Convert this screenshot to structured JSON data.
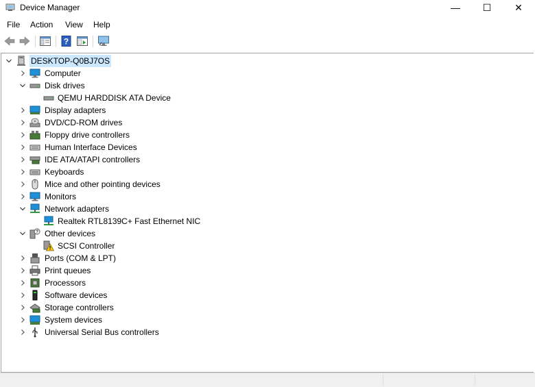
{
  "window": {
    "title": "Device Manager",
    "minimize": "—",
    "maximize": "☐",
    "close": "✕"
  },
  "menu": [
    {
      "label": "File"
    },
    {
      "label": "Action"
    },
    {
      "label": "View"
    },
    {
      "label": "Help"
    }
  ],
  "toolbar": [
    {
      "name": "back-button",
      "icon": "back-arrow-icon"
    },
    {
      "name": "forward-button",
      "icon": "forward-arrow-icon"
    },
    {
      "name": "show-hide-console-tree-button",
      "icon": "console-tree-icon"
    },
    {
      "name": "help-button",
      "icon": "help-icon"
    },
    {
      "name": "properties-button",
      "icon": "properties-icon"
    },
    {
      "name": "scan-hardware-button",
      "icon": "monitor-scan-icon"
    }
  ],
  "tree": {
    "root": {
      "label": "DESKTOP-Q0BJ7OS",
      "expanded": true,
      "icon": "computer-root-icon"
    },
    "categories": [
      {
        "label": "Computer",
        "expanded": false,
        "icon": "computer-icon"
      },
      {
        "label": "Disk drives",
        "expanded": true,
        "icon": "disk-drive-icon",
        "children": [
          {
            "label": "QEMU HARDDISK ATA Device",
            "icon": "disk-drive-icon"
          }
        ]
      },
      {
        "label": "Display adapters",
        "expanded": false,
        "icon": "display-adapter-icon"
      },
      {
        "label": "DVD/CD-ROM drives",
        "expanded": false,
        "icon": "dvd-icon"
      },
      {
        "label": "Floppy drive controllers",
        "expanded": false,
        "icon": "floppy-controller-icon"
      },
      {
        "label": "Human Interface Devices",
        "expanded": false,
        "icon": "hid-icon"
      },
      {
        "label": "IDE ATA/ATAPI controllers",
        "expanded": false,
        "icon": "ide-controller-icon"
      },
      {
        "label": "Keyboards",
        "expanded": false,
        "icon": "keyboard-icon"
      },
      {
        "label": "Mice and other pointing devices",
        "expanded": false,
        "icon": "mouse-icon"
      },
      {
        "label": "Monitors",
        "expanded": false,
        "icon": "monitor-icon"
      },
      {
        "label": "Network adapters",
        "expanded": true,
        "icon": "network-adapter-icon",
        "children": [
          {
            "label": "Realtek RTL8139C+ Fast Ethernet NIC",
            "icon": "network-adapter-icon"
          }
        ]
      },
      {
        "label": "Other devices",
        "expanded": true,
        "icon": "other-devices-icon",
        "children": [
          {
            "label": "SCSI Controller",
            "icon": "warning-device-icon"
          }
        ]
      },
      {
        "label": "Ports (COM & LPT)",
        "expanded": false,
        "icon": "port-icon"
      },
      {
        "label": "Print queues",
        "expanded": false,
        "icon": "printer-icon"
      },
      {
        "label": "Processors",
        "expanded": false,
        "icon": "processor-icon"
      },
      {
        "label": "Software devices",
        "expanded": false,
        "icon": "software-device-icon"
      },
      {
        "label": "Storage controllers",
        "expanded": false,
        "icon": "storage-controller-icon"
      },
      {
        "label": "System devices",
        "expanded": false,
        "icon": "system-device-icon"
      },
      {
        "label": "Universal Serial Bus controllers",
        "expanded": false,
        "icon": "usb-icon"
      }
    ]
  },
  "colors": {
    "selection": "#cce8ff",
    "icon_blue": "#1e90d8",
    "warning_yellow": "#f5c518"
  }
}
